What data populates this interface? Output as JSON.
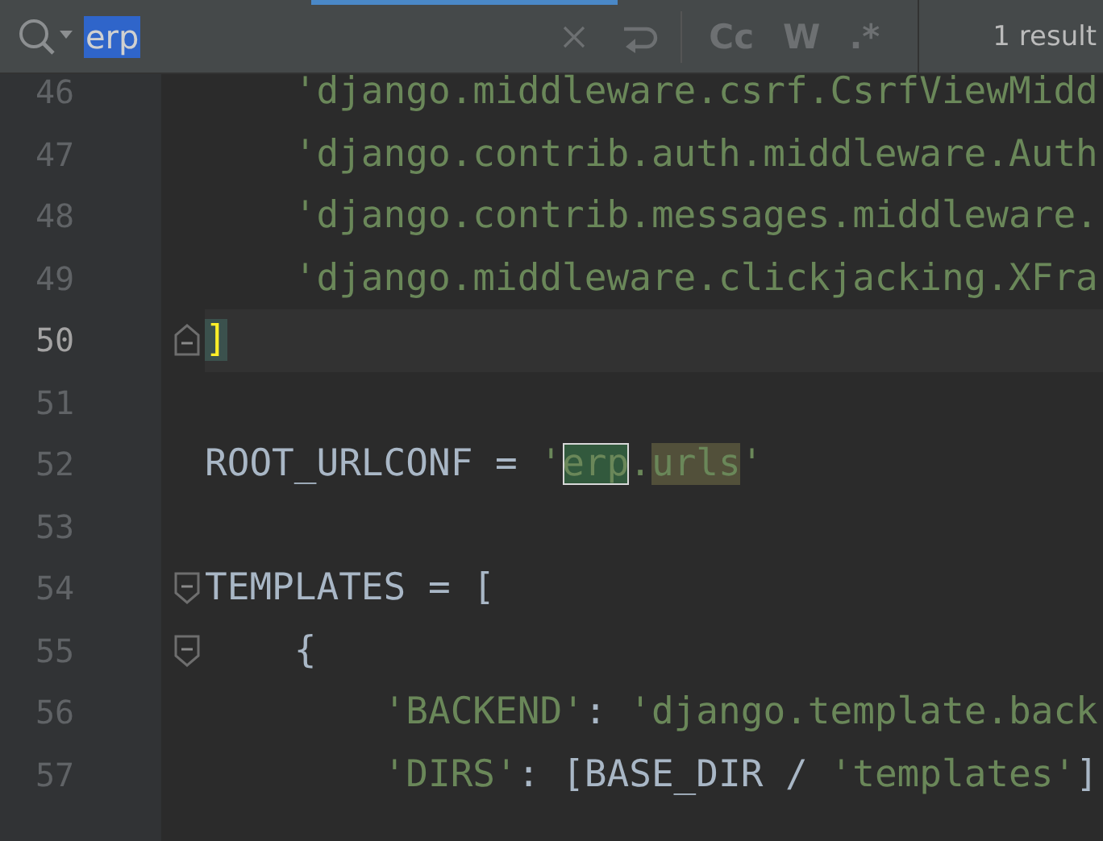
{
  "search": {
    "query": "erp",
    "query_selected": true,
    "options": [
      {
        "label": "Cc",
        "on": false
      },
      {
        "label": "W",
        "on": false
      },
      {
        "label": ".*",
        "on": false
      }
    ],
    "result_count": "1 result"
  },
  "editor": {
    "lines": [
      {
        "number": "46",
        "current": false,
        "fold_start": false,
        "fold_end": false,
        "tokens": [
          {
            "kind": "string",
            "text": "    'django.middleware.csrf.CsrfViewMidd"
          }
        ]
      },
      {
        "number": "47",
        "current": false,
        "fold_start": false,
        "fold_end": false,
        "tokens": [
          {
            "kind": "string",
            "text": "    'django.contrib.auth.middleware.Auth"
          }
        ]
      },
      {
        "number": "48",
        "current": false,
        "fold_start": false,
        "fold_end": false,
        "tokens": [
          {
            "kind": "string",
            "text": "    'django.contrib.messages.middleware."
          }
        ]
      },
      {
        "number": "49",
        "current": false,
        "fold_start": false,
        "fold_end": false,
        "tokens": [
          {
            "kind": "string",
            "text": "    'django.middleware.clickjacking.XFra"
          }
        ]
      },
      {
        "number": "50",
        "current": true,
        "fold_start": false,
        "fold_end": true,
        "tokens": [
          {
            "kind": "bracket-match",
            "text": "]"
          }
        ]
      },
      {
        "number": "51",
        "current": false,
        "fold_start": false,
        "fold_end": false
      },
      {
        "number": "52",
        "current": false,
        "fold_start": false,
        "fold_end": false,
        "tokens": [
          {
            "kind": "plain",
            "text": "ROOT_URLCONF = "
          },
          {
            "kind": "string",
            "text": "'"
          },
          {
            "kind": "current-match",
            "text": "erp"
          },
          {
            "kind": "string",
            "text": "."
          },
          {
            "kind": "occurrence",
            "text": "urls"
          },
          {
            "kind": "string",
            "text": "'"
          }
        ]
      },
      {
        "number": "53",
        "current": false,
        "fold_start": false,
        "fold_end": false
      },
      {
        "number": "54",
        "current": false,
        "fold_start": true,
        "fold_end": false,
        "tokens": [
          {
            "kind": "plain",
            "text": "TEMPLATES = ["
          }
        ]
      },
      {
        "number": "55",
        "current": false,
        "fold_start": true,
        "fold_end": false,
        "tokens": [
          {
            "kind": "plain",
            "text": "    {"
          }
        ]
      },
      {
        "number": "56",
        "current": false,
        "fold_start": false,
        "fold_end": false,
        "tokens": [
          {
            "kind": "string",
            "text": "        'BACKEND'"
          },
          {
            "kind": "plain",
            "text": ": "
          },
          {
            "kind": "string",
            "text": "'django.template.back"
          }
        ]
      },
      {
        "number": "57",
        "current": false,
        "fold_start": false,
        "fold_end": false,
        "tokens": [
          {
            "kind": "string",
            "text": "        'DIRS'"
          },
          {
            "kind": "plain",
            "text": ": [BASE_DIR / "
          },
          {
            "kind": "string",
            "text": "'templates'"
          },
          {
            "kind": "plain",
            "text": "]"
          }
        ]
      }
    ]
  }
}
